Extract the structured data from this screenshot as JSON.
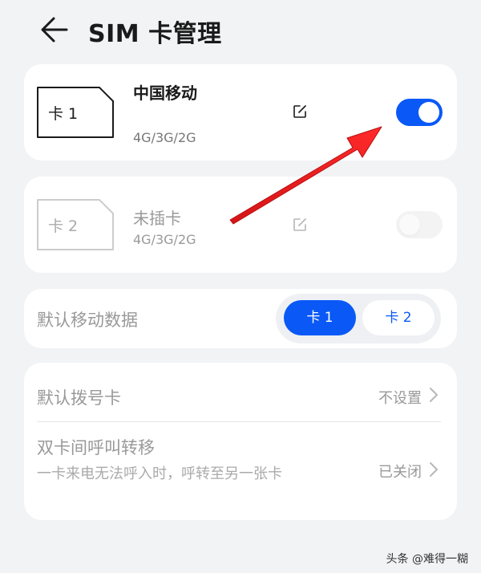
{
  "header": {
    "title": "SIM 卡管理",
    "back_icon": "arrow-left-icon"
  },
  "sim1": {
    "icon_label": "卡 1",
    "carrier": "中国移动",
    "network": "4G/3G/2G",
    "enabled": true,
    "edit_icon": "edit-icon"
  },
  "sim2": {
    "icon_label": "卡 2",
    "carrier": "未插卡",
    "network": "4G/3G/2G",
    "enabled": false,
    "edit_icon": "edit-icon"
  },
  "default_data": {
    "label": "默认移动数据",
    "options": [
      "卡 1",
      "卡 2"
    ],
    "selected": "卡 1"
  },
  "settings": {
    "default_dial": {
      "label": "默认拨号卡",
      "value": "不设置"
    },
    "call_forwarding": {
      "label": "双卡间呼叫转移",
      "description": "一卡来电无法呼入时，呼转至另一张卡",
      "value": "已关闭"
    }
  },
  "watermark": "头条 @难得一糊",
  "colors": {
    "accent": "#0a59f7",
    "annotation_arrow": "#e8171b",
    "background": "#f1f3f5",
    "card": "#ffffff"
  }
}
